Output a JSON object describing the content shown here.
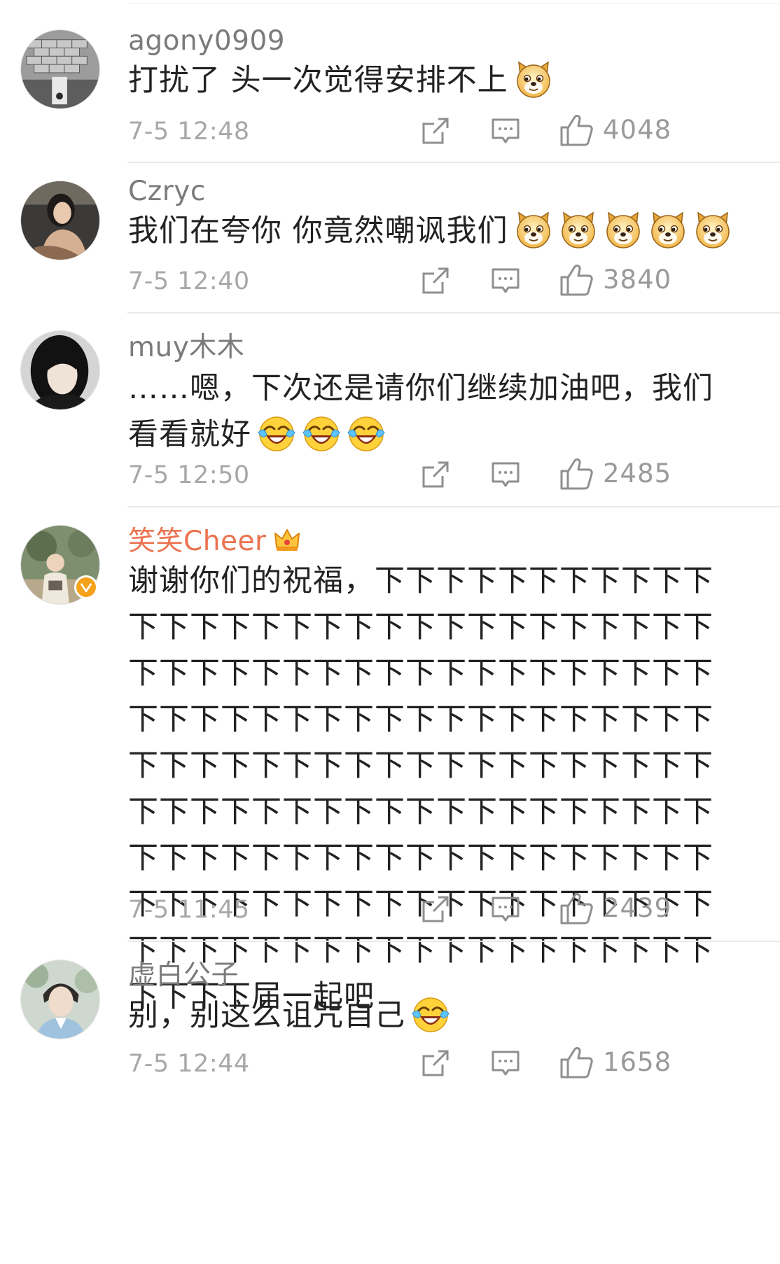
{
  "colors": {
    "username": "#7b7b7b",
    "vip_username": "#eb7350",
    "body_text": "#222222",
    "meta_text": "#a8a8a8",
    "divider": "#e9e9e9",
    "verified_badge": "#f4a21c"
  },
  "icons": {
    "repost": "repost-icon",
    "comment": "comment-icon",
    "like": "thumbs-up-icon",
    "doge": "doge-emoji",
    "laugh_cry": "laugh-cry-emoji",
    "crown": "crown-icon",
    "verified": "verified-badge-icon"
  },
  "comments": [
    {
      "username": "agony0909",
      "text": "打扰了 头一次觉得安排不上",
      "emojis": [
        "doge"
      ],
      "time": "7-5 12:48",
      "likes": "4048"
    },
    {
      "username": "Czryc",
      "text": "我们在夸你 你竟然嘲讽我们",
      "emojis": [
        "doge",
        "doge",
        "doge",
        "doge",
        "doge"
      ],
      "time": "7-5 12:40",
      "likes": "3840"
    },
    {
      "username": "muy木木",
      "text": "……嗯，下次还是请你们继续加油吧，我们看看就好",
      "emojis": [
        "laugh_cry",
        "laugh_cry",
        "laugh_cry"
      ],
      "time": "7-5 12:50",
      "likes": "2485"
    },
    {
      "username": "笑笑Cheer",
      "vip": true,
      "verified": true,
      "text": "谢谢你们的祝福，下下下下下下下下下下下下下下下下下下下下下下下下下下下下下下下下下下下下下下下下下下下下下下下下下下下下下下下下下下下下下下下下下下下下下下下下下下下下下下下下下下下下下下下下下下下下下下下下下下下下下下下下下下下下下下下下下下下下下下下下下下下下下下下下下下下下下下下下下下下下下下下下下下下下下下下下下下下下下下下下下下下下下下下届一起吧",
      "emojis": [],
      "time": "7-5 11:45",
      "likes": "2439"
    },
    {
      "username": "虚白公子",
      "text": "别，别这么诅咒自己",
      "emojis": [
        "laugh_cry"
      ],
      "time": "7-5 12:44",
      "likes": "1658"
    }
  ]
}
